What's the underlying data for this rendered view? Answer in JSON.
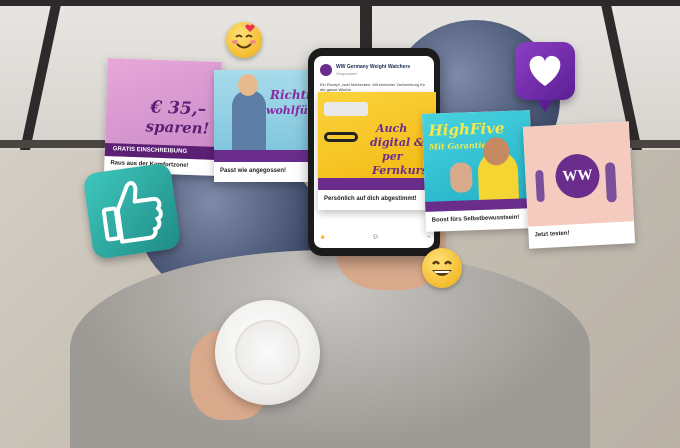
{
  "post": {
    "page_name": "WW Germany Weight Watchers",
    "meta": "Gesponsert",
    "text": "Ein Rezept, zwei Mahlzeiten: Mit einfacher Vorbereitung für die ganze Woche"
  },
  "cards": [
    {
      "headline": "€ 35,–",
      "headline2": "sparen!",
      "banner": "GRATIS EINSCHREIBUNG",
      "caption": "Raus aus der Komfortzone!"
    },
    {
      "headline": "Richtig",
      "headline2": "wohlfühlen",
      "caption": "Passt wie angegossen!"
    },
    {
      "headline": "Auch",
      "headline2": "digital &",
      "headline3": "per",
      "headline4": "Fernkurs",
      "caption": "Persönlich auf dich abgestimmt!"
    },
    {
      "headline": "HighFive",
      "headline2": "Mit Garantie!",
      "caption": "Boost fürs Selbstbewusstsein!"
    },
    {
      "logo": "WW",
      "caption": "Jetzt testen!"
    }
  ],
  "icons": {
    "heart": "heart-bubble-icon",
    "thumb": "thumbs-up-icon",
    "emoji_love": "smiling-blush-emoji-icon",
    "emoji_grin": "grinning-emoji-icon"
  },
  "colors": {
    "brand_purple": "#6b2d8c",
    "card_yellow": "#f5c518",
    "card_pink": "#f4c7bd",
    "card_blue": "#88cbe0",
    "card_cyan": "#2fc6d6"
  }
}
